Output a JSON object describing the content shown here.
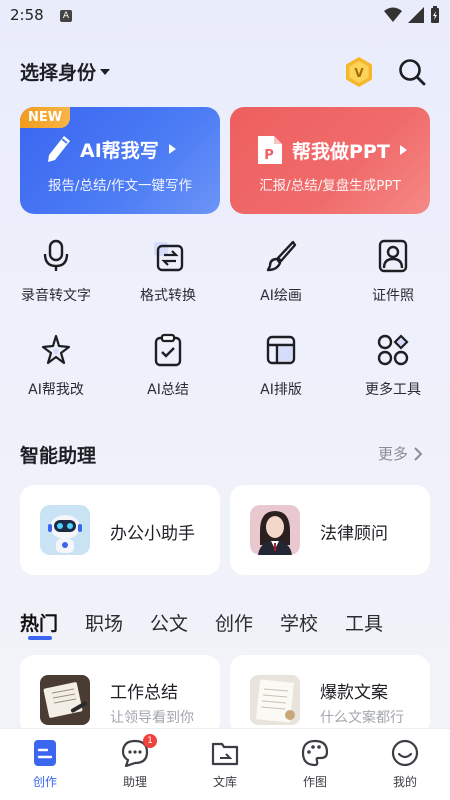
{
  "status_bar": {
    "time": "2:58",
    "notification_letter": "A"
  },
  "header": {
    "identity_label": "选择身份",
    "vip_letter": "V"
  },
  "promo_cards": [
    {
      "badge": "NEW",
      "title": "AI帮我写",
      "subtitle": "报告/总结/作文一键写作"
    },
    {
      "title": "帮我做PPT",
      "subtitle": "汇报/总结/复盘生成PPT"
    }
  ],
  "tools": [
    {
      "label": "录音转文字",
      "icon": "microphone-icon"
    },
    {
      "label": "格式转换",
      "icon": "format-convert-icon"
    },
    {
      "label": "AI绘画",
      "icon": "paintbrush-icon"
    },
    {
      "label": "证件照",
      "icon": "id-photo-icon"
    },
    {
      "label": "AI帮我改",
      "icon": "sparkle-edit-icon"
    },
    {
      "label": "AI总结",
      "icon": "clipboard-check-icon"
    },
    {
      "label": "AI排版",
      "icon": "layout-icon"
    },
    {
      "label": "更多工具",
      "icon": "grid-more-icon"
    }
  ],
  "assistants": {
    "title": "智能助理",
    "more": "更多",
    "items": [
      {
        "name": "办公小助手",
        "avatar": "robot-avatar"
      },
      {
        "name": "法律顾问",
        "avatar": "lawyer-avatar"
      }
    ]
  },
  "category_tabs": [
    "热门",
    "职场",
    "公文",
    "创作",
    "学校",
    "工具"
  ],
  "active_tab": "热门",
  "docs": [
    {
      "title": "工作总结",
      "subtitle": "让领导看到你"
    },
    {
      "title": "爆款文案",
      "subtitle": "什么文案都行"
    }
  ],
  "bottom_nav": [
    {
      "label": "创作",
      "icon": "create-icon",
      "active": true
    },
    {
      "label": "助理",
      "icon": "chat-icon",
      "badge": "1"
    },
    {
      "label": "文库",
      "icon": "folder-icon"
    },
    {
      "label": "作图",
      "icon": "palette-icon"
    },
    {
      "label": "我的",
      "icon": "smile-icon"
    }
  ],
  "colors": {
    "accent": "#3a66f0",
    "ppt": "#ee5f5f",
    "new_badge": "#f39b1e"
  }
}
